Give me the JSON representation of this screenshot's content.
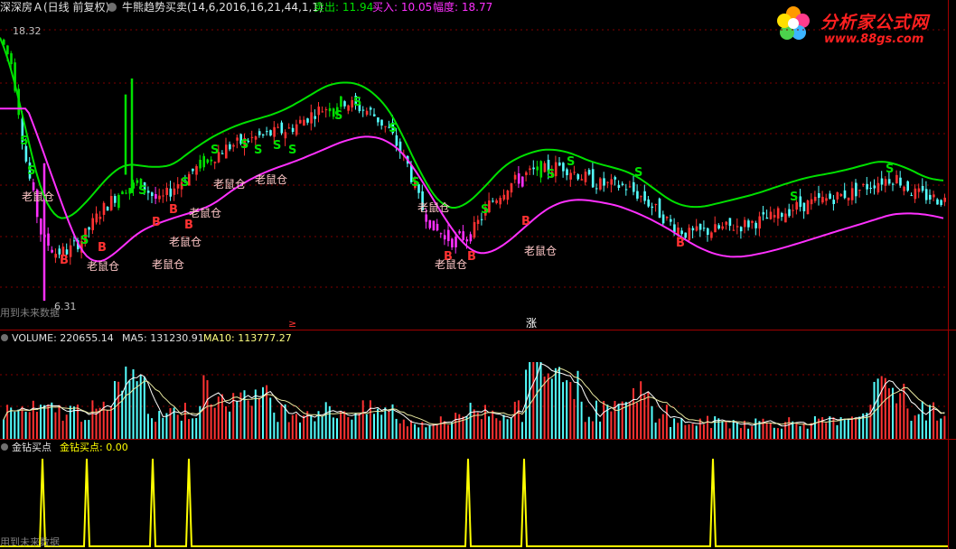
{
  "header": {
    "security": "深深房Ａ(日线 前复权)",
    "indicator": "牛熊趋势买卖(14,6,2016,16,21,44,1,1)",
    "sell_label": "卖出: 11.94",
    "buy_label": "买入: 10.05",
    "range_label": "幅度: 18.77"
  },
  "logo": {
    "title": "分析家公式网",
    "url": "www.88gs.com"
  },
  "price_panel": {
    "high_label": "18.32",
    "low_label": "6.31",
    "future_note": "用到未来数据",
    "signal_sell": "S",
    "signal_buy": "B",
    "rat_label": "老鼠仓",
    "mark_limit_up": "涨",
    "mark_limit_down": "≥"
  },
  "volume_panel": {
    "vol_label": "VOLUME: 220655.14",
    "ma5_label": "MA5: 131230.91",
    "ma10_label": "MA10: 113777.27"
  },
  "signal_panel": {
    "name": "金钻买点",
    "value_label": "金钻买点: 0.00",
    "future_note": "用到未来数据"
  },
  "colors": {
    "up": "#ff3232",
    "down": "#54ffff",
    "green_line": "#00e000",
    "magenta_line": "#ff30ff",
    "yellow": "#ffff00",
    "grid": "#800000"
  },
  "chart_data": {
    "type": "candlestick",
    "price_range": [
      6.31,
      18.32
    ],
    "sell_level": 11.94,
    "buy_level": 10.05,
    "amplitude": 18.77,
    "volume_last": 220655.14,
    "volume_ma5": 131230.91,
    "volume_ma10": 113777.27,
    "signal_value": 0.0
  }
}
